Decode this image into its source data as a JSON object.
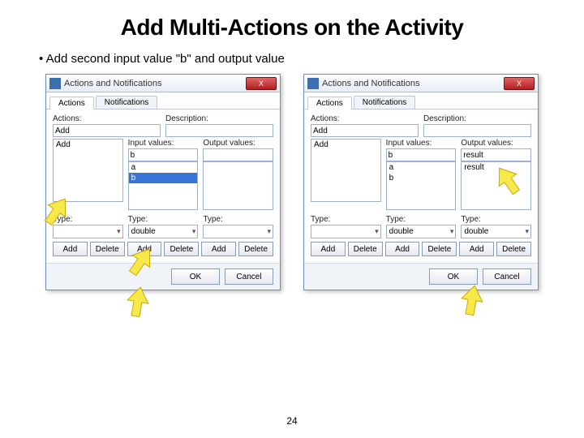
{
  "title": "Add Multi-Actions on the Activity",
  "bullet1": "Add second input value \"b\" and output value",
  "pagenum": "24",
  "dialogLeft": {
    "windowTitle": "Actions and Notifications",
    "close": "X",
    "tabActions": "Actions",
    "tabNotifications": "Notifications",
    "lblActions": "Actions:",
    "lblDescription": "Description:",
    "actionsField": "Add",
    "lblInputValues": "Input values:",
    "lblOutputValues": "Output values:",
    "inputField": "b",
    "listActions": [
      "Add"
    ],
    "listInputs": [
      {
        "text": "a",
        "sel": false
      },
      {
        "text": "b",
        "sel": true
      }
    ],
    "listOutputs": [],
    "lblType": "Type:",
    "type1": "",
    "type2": "double",
    "type3": "",
    "btnAdd": "Add",
    "btnDelete": "Delete",
    "btnOK": "OK",
    "btnCancel": "Cancel"
  },
  "dialogRight": {
    "windowTitle": "Actions and Notifications",
    "close": "X",
    "tabActions": "Actions",
    "tabNotifications": "Notifications",
    "lblActions": "Actions:",
    "lblDescription": "Description:",
    "actionsField": "Add",
    "lblInputValues": "Input values:",
    "lblOutputValues": "Output values:",
    "inputField": "b",
    "outputField": "result",
    "listActions": [
      "Add"
    ],
    "listInputs": [
      {
        "text": "a",
        "sel": false
      },
      {
        "text": "b",
        "sel": false
      }
    ],
    "listOutputs": [
      {
        "text": "result",
        "sel": false
      }
    ],
    "lblType": "Type:",
    "type1": "",
    "type2": "double",
    "type3": "double",
    "btnAdd": "Add",
    "btnDelete": "Delete",
    "btnOK": "OK",
    "btnCancel": "Cancel"
  }
}
